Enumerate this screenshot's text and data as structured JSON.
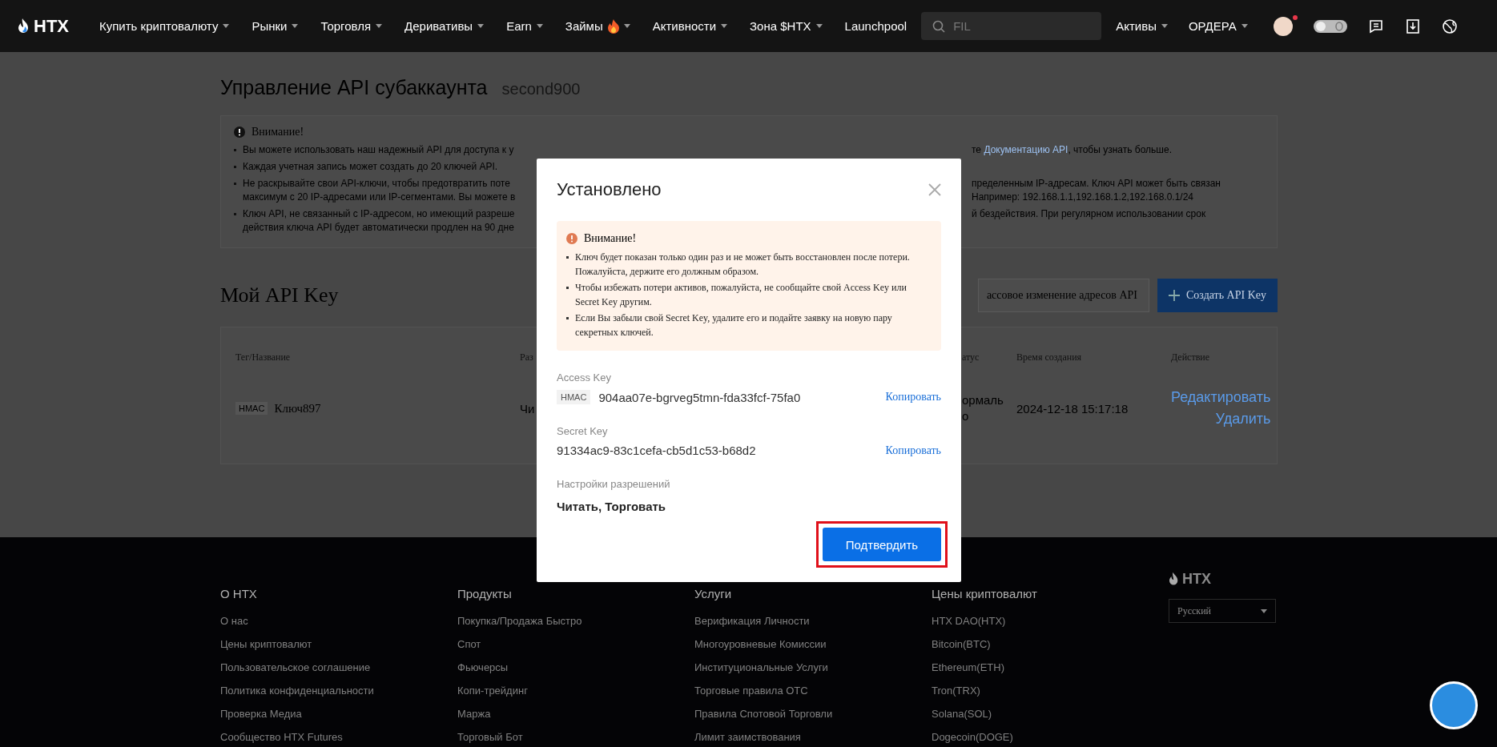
{
  "nav": {
    "menu": [
      {
        "label": "Купить криптовалюту",
        "dropdown": true,
        "hot": false
      },
      {
        "label": "Рынки",
        "dropdown": true,
        "hot": false
      },
      {
        "label": "Торговля",
        "dropdown": true,
        "hot": false
      },
      {
        "label": "Деривативы",
        "dropdown": true,
        "hot": false
      },
      {
        "label": "Earn",
        "dropdown": true,
        "hot": false
      },
      {
        "label": "Займы",
        "dropdown": true,
        "hot": true
      },
      {
        "label": "Активности",
        "dropdown": true,
        "hot": false
      },
      {
        "label": "Зона $HTX",
        "dropdown": true,
        "hot": false
      },
      {
        "label": "Launchpool",
        "dropdown": false,
        "hot": false
      }
    ],
    "search": {
      "placeholder": "FIL"
    },
    "right_menu": [
      {
        "label": "Активы",
        "dropdown": true
      },
      {
        "label": "ОРДЕРА",
        "dropdown": true
      }
    ],
    "avatar_badge": true
  },
  "page": {
    "title": "Управление API субаккаунта",
    "subaccount": "second900",
    "notice": {
      "title": "Внимание!",
      "bullets": [
        {
          "left": [
            "Вы можете использовать наш надежный API для доступа к у"
          ],
          "right": [
            [
              {
                "text": "те "
              },
              {
                "text": "Документацию API",
                "link": true
              },
              {
                "text": ", чтобы узнать больше."
              }
            ]
          ]
        },
        {
          "left": [
            "Каждая учетная запись может создать до 20 ключей API."
          ]
        },
        {
          "left": [
            "Не раскрывайте свои API-ключи, чтобы предотвратить поте",
            "максимум с 20 IP-адресами или IP-сегментами. Вы можете в"
          ],
          "right": [
            [
              {
                "text": "пределенным IP-адресам. Ключ API может быть связан"
              }
            ],
            [
              {
                "text": "Например: 192.168.1.1,192.168.1.2,192.168.0.1/24"
              }
            ]
          ]
        },
        {
          "left": [
            "Ключ API, не связанный с IP-адресом, но имеющий разреше",
            "действия ключа API будет автоматически продлен на 90 дне"
          ],
          "right": [
            [
              {
                "text": "й бездействия. При регулярном использовании срок"
              }
            ]
          ]
        }
      ]
    },
    "keys_title": "Мой API Key",
    "buttons": [
      {
        "label": "ассовое изменение адресов API",
        "kind": "outline"
      },
      {
        "label": "Создать API Key",
        "kind": "primary"
      }
    ],
    "table": {
      "columns": [
        "Тег/Название",
        "Раз",
        "атус",
        "Время создания",
        "Действие"
      ],
      "rows": [
        {
          "tag": "HMAC",
          "name": "Ключ897",
          "column_2": "Чи",
          "status": [
            "ормаль",
            "о"
          ],
          "created": "2024-12-18 15:17:18",
          "actions": [
            "Редактировать",
            "Удалить"
          ]
        }
      ]
    }
  },
  "dialog": {
    "title": "Установлено",
    "notice": {
      "title": "Внимание!",
      "items": [
        "Ключ будет показан только один раз и не может быть восстановлен после потери. Пожалуйста, держите его должным образом.",
        "Чтобы избежать потери активов, пожалуйста, не сообщайте свой Access Key или Secret Key другим.",
        "Если Вы забыли свой Secret Key, удалите его и подайте заявку на новую пару секретных ключей."
      ]
    },
    "fields": [
      {
        "label": "Access Key",
        "tag": "HMAC",
        "value": "904aa07e-bgrveg5tmn-fda33fcf-75fa0",
        "action": "Копировать"
      },
      {
        "label": "Secret Key",
        "value": "91334ac9-83c1cefa-cb5d1c53-b68d2",
        "action": "Копировать"
      }
    ],
    "permissions_label": "Настройки разрешений",
    "permissions": "Читать, Торговать",
    "confirm": "Подтвердить",
    "highlighted": true
  },
  "footer": {
    "columns": [
      {
        "title": "О HTX",
        "links": [
          "О нас",
          "Цены криптовалют",
          "Пользовательское соглашение",
          "Политика конфиденциальности",
          "Проверка Медиа",
          "Сообщество HTX Futures"
        ]
      },
      {
        "title": "Продукты",
        "links": [
          "Покупка/Продажа Быстро",
          "Спот",
          "Фьючерсы",
          "Копи-трейдинг",
          "Маржа",
          "Торговый Бот"
        ]
      },
      {
        "title": "Услуги",
        "links": [
          "Верификация Личности",
          "Многоуровневые Комиссии",
          "Институциональные Услуги",
          "Торговые правила OTC",
          "Правила Спотовой Торговли",
          "Лимит заимствования"
        ]
      },
      {
        "title": "Цены криптовалют",
        "links": [
          "HTX DAO(HTX)",
          "Bitcoin(BTC)",
          "Ethereum(ETH)",
          "Tron(TRX)",
          "Solana(SOL)",
          "Dogecoin(DOGE)"
        ]
      }
    ],
    "logo": "HTX",
    "language": "Русский"
  },
  "logo": "HTX"
}
